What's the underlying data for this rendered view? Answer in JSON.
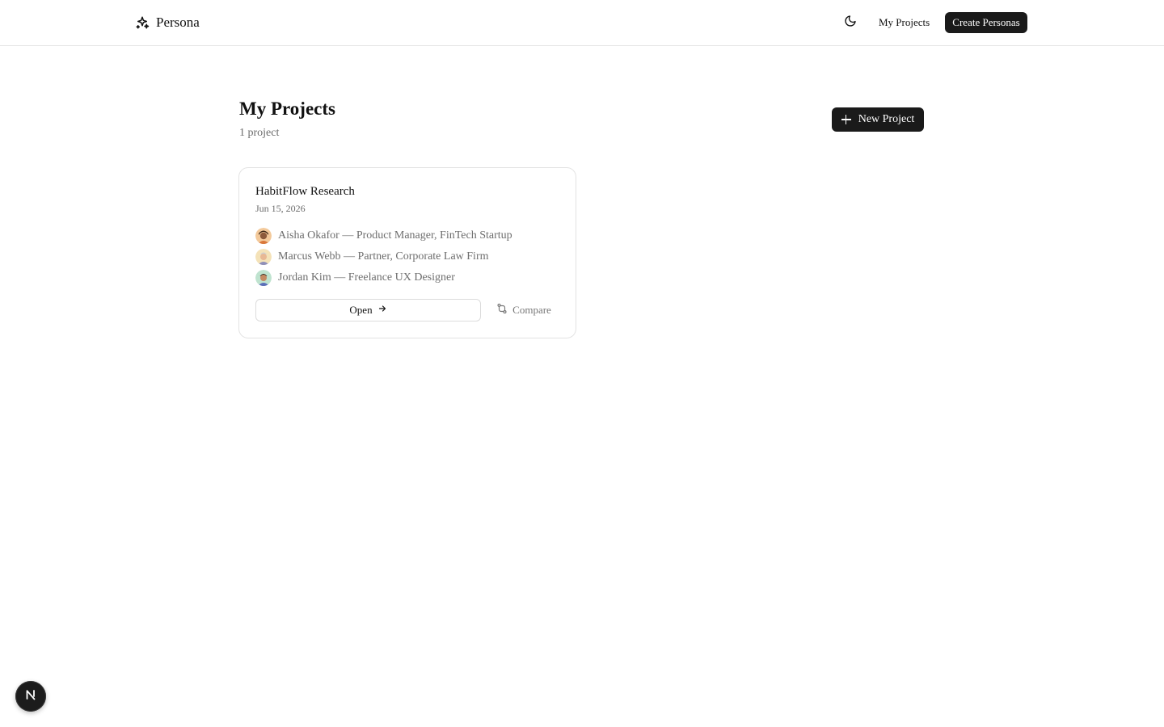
{
  "header": {
    "brand_name": "Persona",
    "brand_icon": "sparkles-icon",
    "theme_toggle_icon": "moon-icon",
    "nav_my_projects": "My Projects",
    "create_button": "Create Personas"
  },
  "page": {
    "title": "My Projects",
    "subtitle": "1 project",
    "new_project_button": "New Project"
  },
  "projects": [
    {
      "name": "HabitFlow Research",
      "date": "Jun 15, 2026",
      "personas": [
        {
          "name": "Aisha Okafor",
          "role": "Product Manager, FinTech Startup"
        },
        {
          "name": "Marcus Webb",
          "role": "Partner, Corporate Law Firm"
        },
        {
          "name": "Jordan Kim",
          "role": "Freelance UX Designer"
        }
      ],
      "open_label": "Open",
      "compare_label": "Compare"
    }
  ],
  "dev_badge": {
    "icon": "nextjs-n-icon",
    "letter": "N"
  },
  "colors": {
    "primary_button": "#1a1a1a",
    "border": "#e3e3e3",
    "muted_text": "#6e6e6e"
  }
}
